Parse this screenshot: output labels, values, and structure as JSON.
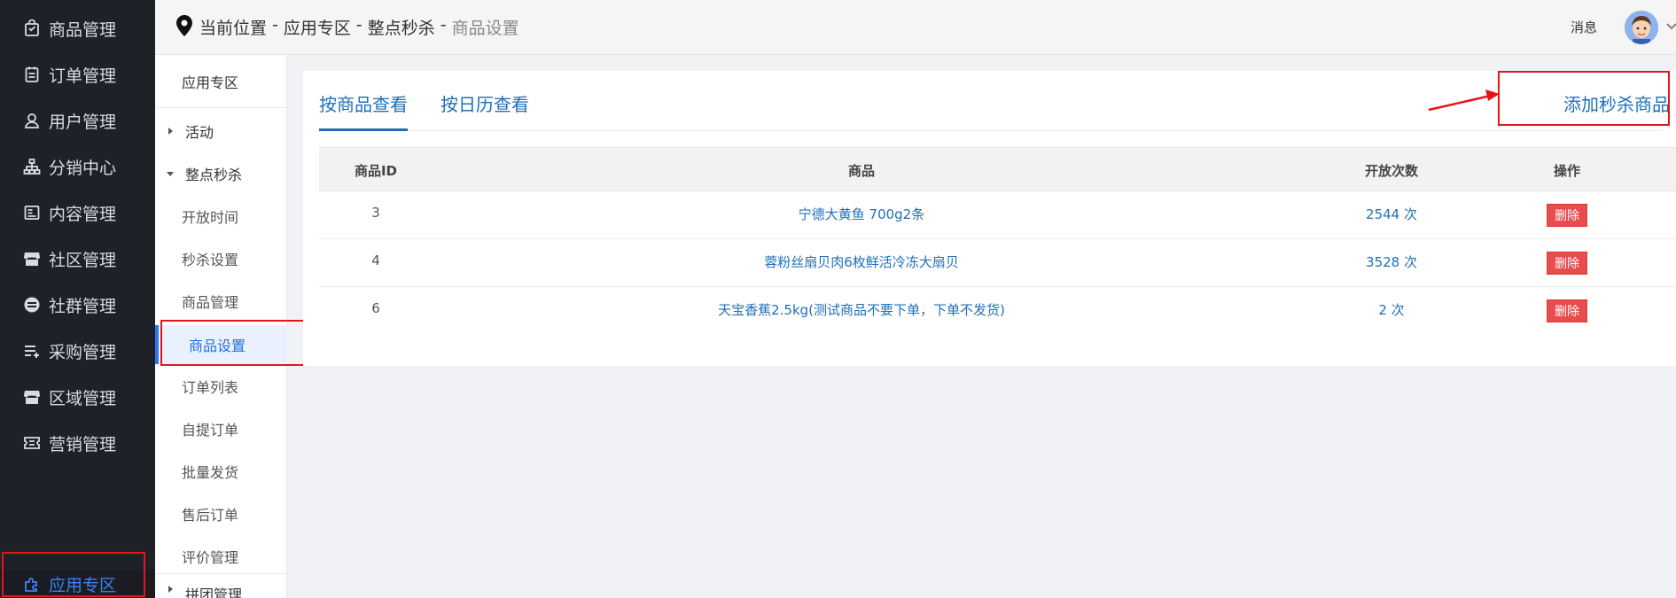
{
  "sidebar": {
    "items": [
      {
        "label": "商品管理",
        "icon": "bag-icon",
        "active": false
      },
      {
        "label": "订单管理",
        "icon": "clipboard-icon",
        "active": false
      },
      {
        "label": "用户管理",
        "icon": "user-icon",
        "active": false
      },
      {
        "label": "分销中心",
        "icon": "org-chart-icon",
        "active": false
      },
      {
        "label": "内容管理",
        "icon": "document-icon",
        "active": false
      },
      {
        "label": "社区管理",
        "icon": "store-icon",
        "active": false
      },
      {
        "label": "社群管理",
        "icon": "circle-minus-icon",
        "active": false
      },
      {
        "label": "采购管理",
        "icon": "list-plus-icon",
        "active": false
      },
      {
        "label": "区域管理",
        "icon": "store-icon",
        "active": false
      },
      {
        "label": "营销管理",
        "icon": "ticket-icon",
        "active": false
      },
      {
        "label": "应用专区",
        "icon": "puzzle-icon",
        "active": true
      }
    ]
  },
  "header": {
    "breadcrumb": [
      "当前位置",
      "应用专区",
      "整点秒杀",
      "商品设置"
    ],
    "separator": "-",
    "message_label": "消息"
  },
  "subnav": {
    "title": "应用专区",
    "groups": [
      {
        "label": "活动",
        "expanded": false
      },
      {
        "label": "整点秒杀",
        "expanded": true
      }
    ],
    "items": [
      "开放时间",
      "秒杀设置",
      "商品管理",
      "商品设置",
      "订单列表",
      "自提订单",
      "批量发货",
      "售后订单",
      "评价管理"
    ],
    "active_item": "商品设置",
    "partial_group": "拼团管理"
  },
  "tabs": [
    {
      "label": "按商品查看",
      "active": true
    },
    {
      "label": "按日历查看",
      "active": false
    }
  ],
  "add_button_label": "添加秒杀商品",
  "table": {
    "headers": [
      "商品ID",
      "商品",
      "开放次数",
      "操作"
    ],
    "rows": [
      {
        "id": "3",
        "product": "宁德大黄鱼 700g2条",
        "count": "2544 次",
        "action": "删除"
      },
      {
        "id": "4",
        "product": "蓉粉丝扇贝肉6枚鲜活冷冻大扇贝",
        "count": "3528 次",
        "action": "删除"
      },
      {
        "id": "6",
        "product": "天宝香蕉2.5kg(测试商品不要下单，下单不发货)",
        "count": "2 次",
        "action": "删除"
      }
    ]
  },
  "colors": {
    "sidebar_bg": "#1f2128",
    "accent": "#1f6fb8",
    "active_blue": "#3b82f6",
    "delete_red": "#e84c4c",
    "highlight_red": "#e5141b"
  }
}
